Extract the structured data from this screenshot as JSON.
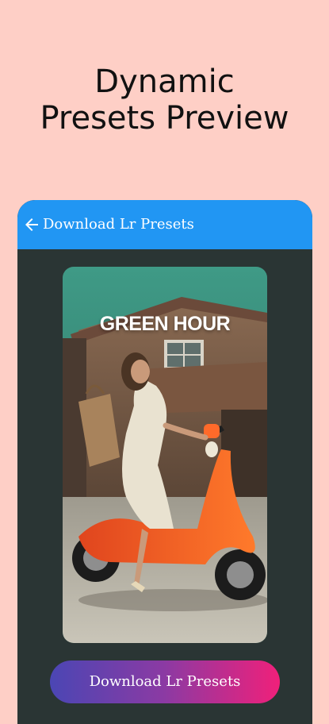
{
  "headline": {
    "line1": "Dynamic",
    "line2": "Presets Preview"
  },
  "appbar": {
    "back_icon": "arrow-left-icon",
    "title": "Download Lr Presets"
  },
  "preview": {
    "label": "GREEN HOUR"
  },
  "download_button": {
    "label": "Download Lr Presets"
  },
  "colors": {
    "background": "#FECFC6",
    "appbar": "#2196F3",
    "phone_body": "#2A3534",
    "button_gradient_start": "#4B46B4",
    "button_gradient_end": "#F0207A"
  }
}
